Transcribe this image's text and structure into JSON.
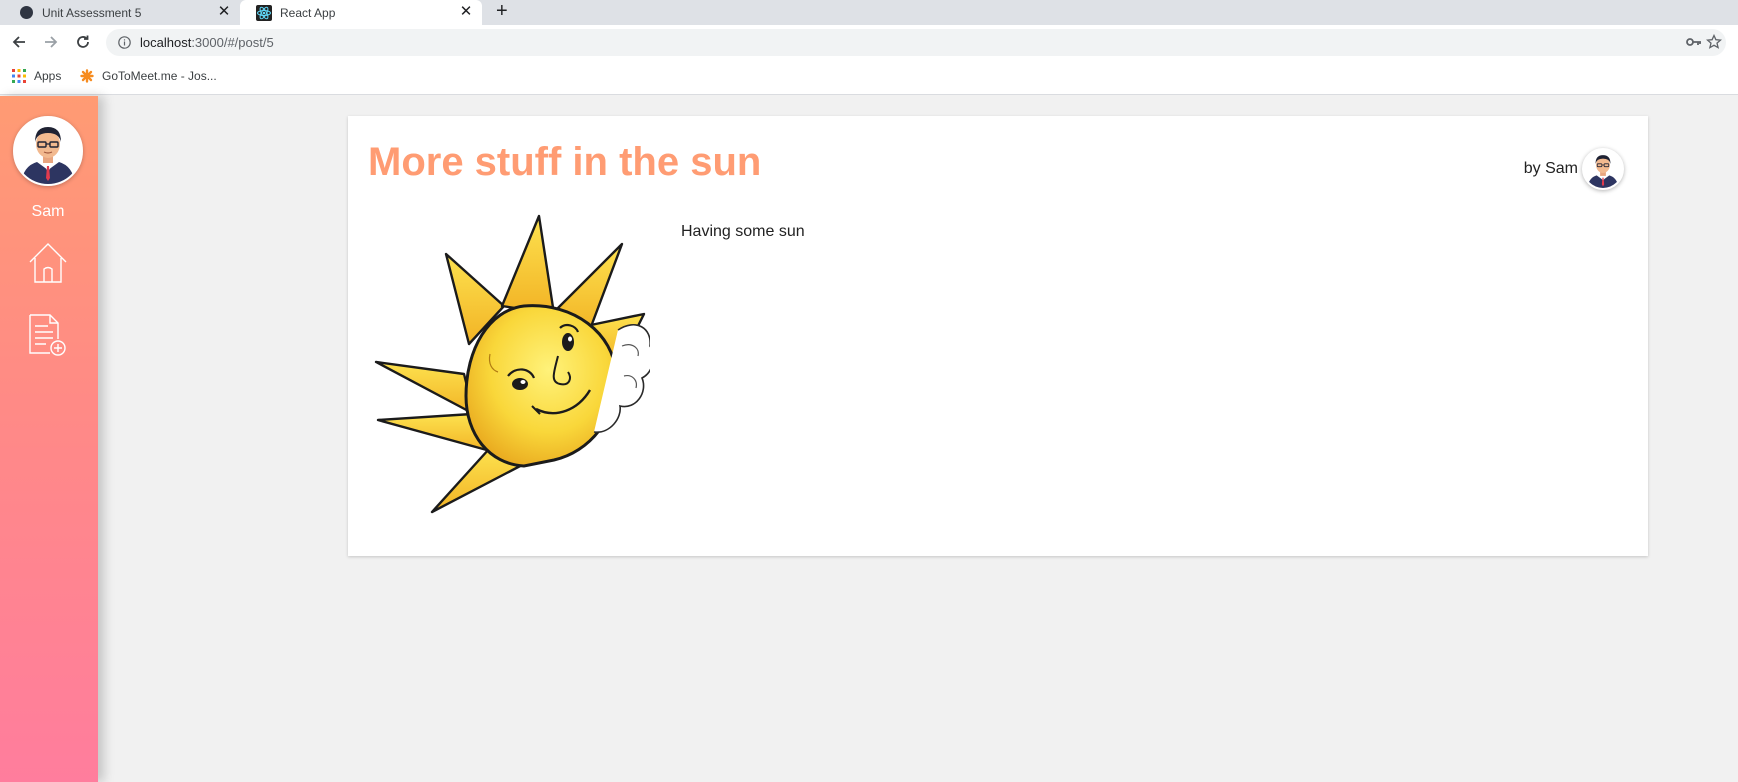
{
  "browser": {
    "tabs": [
      {
        "label": "Unit Assessment 5",
        "active": false
      },
      {
        "label": "React App",
        "active": true
      }
    ],
    "new_tab_icon": "plus-icon",
    "url_host": "localhost",
    "url_path": ":3000/#/post/5",
    "bookmarks": [
      {
        "label": "Apps",
        "icon": "apps-grid-icon"
      },
      {
        "label": "GoToMeet.me - Jos...",
        "icon": "gotomeet-icon"
      }
    ]
  },
  "sidebar": {
    "username": "Sam",
    "nav": [
      {
        "icon": "home-icon"
      },
      {
        "icon": "new-post-icon"
      }
    ]
  },
  "post": {
    "title": "More stuff in the sun",
    "author_label": "by Sam",
    "content": "Having some sun"
  },
  "colors": {
    "title": "#ff9c73",
    "sidebar_top": "#ff9b73",
    "sidebar_bottom": "#ff7d9d",
    "page_bg": "#f1f1f1"
  }
}
